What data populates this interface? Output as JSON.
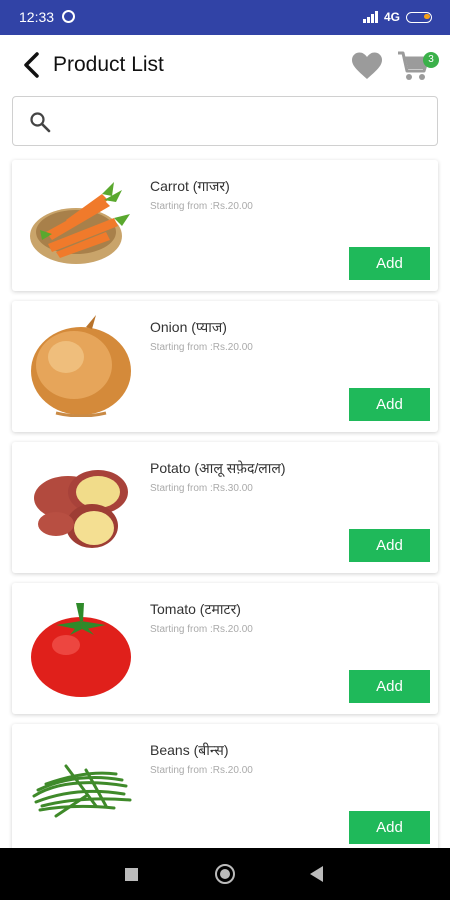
{
  "status_bar": {
    "time": "12:33",
    "network": "4G",
    "bg_color": "#3143a6"
  },
  "header": {
    "title": "Product List",
    "cart_count": "3"
  },
  "search": {
    "placeholder": "",
    "value": ""
  },
  "products": [
    {
      "name": "Carrot (गाजर)",
      "price": "Starting from :Rs.20.00",
      "add_label": "Add",
      "icon": "carrot-image"
    },
    {
      "name": "Onion (प्याज)",
      "price": "Starting from :Rs.20.00",
      "add_label": "Add",
      "icon": "onion-image"
    },
    {
      "name": "Potato (आलू सफ़ेद/लाल)",
      "price": "Starting from :Rs.30.00",
      "add_label": "Add",
      "icon": "potato-image"
    },
    {
      "name": "Tomato (टमाटर)",
      "price": "Starting from :Rs.20.00",
      "add_label": "Add",
      "icon": "tomato-image"
    },
    {
      "name": "Beans (बीन्स)",
      "price": "Starting from :Rs.20.00",
      "add_label": "Add",
      "icon": "beans-image"
    }
  ],
  "colors": {
    "accent_green": "#1fb95a",
    "badge_green": "#3bb14a"
  }
}
